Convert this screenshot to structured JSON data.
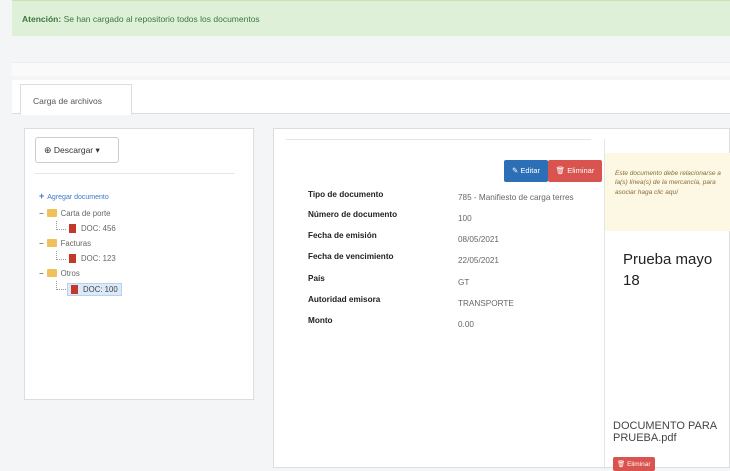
{
  "alert": {
    "label": "Atención:",
    "message": "Se han cargado al repositorio todos los documentos"
  },
  "tabs": [
    {
      "label": "Carga de archivos"
    }
  ],
  "download": {
    "label": "Descargar",
    "icon": "download-icon"
  },
  "tree": {
    "add_label": "Agregar documento",
    "nodes": [
      {
        "label": "Carta de porte",
        "children": [
          {
            "label": "DOC: 456"
          }
        ]
      },
      {
        "label": "Facturas",
        "children": [
          {
            "label": "DOC: 123"
          }
        ]
      },
      {
        "label": "Otros",
        "children": [
          {
            "label": "DOC: 100",
            "selected": true
          }
        ]
      }
    ]
  },
  "actions": {
    "edit_label": "Editar",
    "delete_label": "Eliminar"
  },
  "fields": [
    {
      "label": "Tipo de documento",
      "value": "785 - Manifiesto de carga terres"
    },
    {
      "label": "Número de documento",
      "value": "100"
    },
    {
      "label": "Fecha de emisión",
      "value": "08/05/2021"
    },
    {
      "label": "Fecha de vencimiento",
      "value": "22/05/2021"
    },
    {
      "label": "País",
      "value": "GT"
    },
    {
      "label": "Autoridad emisora",
      "value": "TRANSPORTE"
    },
    {
      "label": "Monto",
      "value": "0.00"
    }
  ],
  "note": "Este documento debe relacionarse a la(s) línea(s) de la mercancía, para asociar haga clic aquí",
  "preview": {
    "title": "Prueba mayo 18",
    "file": "DOCUMENTO PARA PRUEBA.pdf",
    "delete_label": "Eliminar"
  },
  "colors": {
    "alert_bg": "#dff0d8",
    "edit": "#2d6fb7",
    "delete": "#d9534f",
    "note_bg": "#fcf8e3"
  }
}
